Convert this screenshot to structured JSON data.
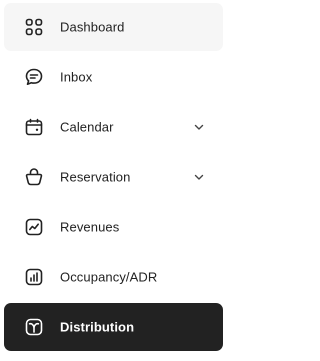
{
  "sidebar": {
    "items": [
      {
        "label": "Dashboard",
        "icon": "grid-icon",
        "expandable": false,
        "state": "hover"
      },
      {
        "label": "Inbox",
        "icon": "chat-bubble-icon",
        "expandable": false
      },
      {
        "label": "Calendar",
        "icon": "calendar-icon",
        "expandable": true
      },
      {
        "label": "Reservation",
        "icon": "bag-icon",
        "expandable": true
      },
      {
        "label": "Revenues",
        "icon": "trend-chart-icon",
        "expandable": false
      },
      {
        "label": "Occupancy/ADR",
        "icon": "bar-chart-icon",
        "expandable": false
      },
      {
        "label": "Distribution",
        "icon": "distribution-icon",
        "expandable": false,
        "state": "active"
      }
    ]
  },
  "colors": {
    "active_bg": "#222222",
    "active_text": "#ffffff",
    "hover_bg": "#f6f6f6",
    "text": "#222222"
  }
}
